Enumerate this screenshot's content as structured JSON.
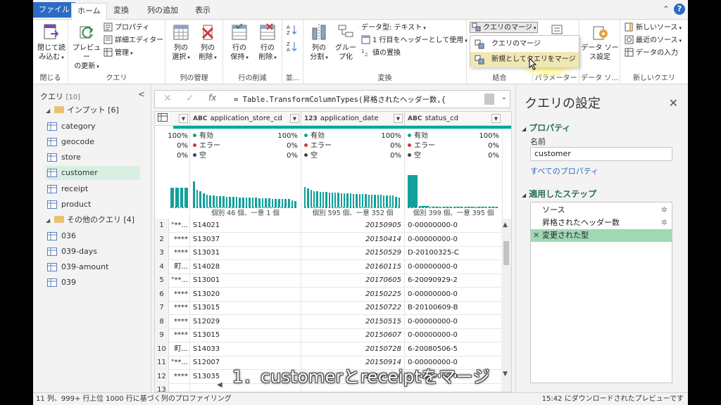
{
  "tabs": [
    "ファイル",
    "ホーム",
    "変換",
    "列の追加",
    "表示"
  ],
  "ribbon": {
    "close_group": {
      "btn": "閉じて読\nみ込む",
      "label": "閉じる"
    },
    "query_group": {
      "preview": "プレビュー\nの更新",
      "properties": "プロパティ",
      "advanced_editor": "詳細エディター",
      "manage": "管理",
      "label": "クエリ"
    },
    "columns_group": {
      "select": "列の\n選択",
      "remove": "列の\n削除",
      "label": "列の管理"
    },
    "rows_group": {
      "keep": "行の\n保持",
      "remove": "行の\n削除",
      "label": "行の削減"
    },
    "sort_group": {
      "label": "並..."
    },
    "transform_group": {
      "split": "列の\n分割",
      "group": "グルー\nプ化",
      "datatype": "データ型: テキスト",
      "first_row": "1 行目をヘッダーとして使用",
      "replace": "値の置換",
      "label": "変換"
    },
    "combine_group": {
      "merge": "クエリのマージ",
      "label": "結合"
    },
    "params_group": {
      "label": "パラメーター"
    },
    "datasource_group": {
      "btn": "データ ソー\nス設定",
      "label": "データ ソ..."
    },
    "newquery_group": {
      "new_source": "新しいソース",
      "recent": "最近のソース",
      "enter_data": "データの入力",
      "label": "新しいクエリ"
    }
  },
  "merge_dropdown": {
    "item1": "クエリのマージ",
    "item2": "新規としてクエリをマージ"
  },
  "queries": {
    "header": "クエリ",
    "count": "[10]",
    "folder1": {
      "name": "インプット [6]",
      "items": [
        "category",
        "geocode",
        "store",
        "customer",
        "receipt",
        "product"
      ]
    },
    "folder2": {
      "name": "その他のクエリ [4]",
      "items": [
        "036",
        "039-days",
        "039-amount",
        "039"
      ]
    }
  },
  "formula": "= Table.TransformColumnTypes(昇格されたヘッダー数,{",
  "columns": [
    {
      "type": "ABC",
      "name": "application_store_cd"
    },
    {
      "type": "123",
      "name": "application_date"
    },
    {
      "type": "ABC",
      "name": "status_cd"
    }
  ],
  "profile": {
    "labels": {
      "valid": "有効",
      "error": "エラー",
      "empty": "空"
    },
    "partial": {
      "valid": "100%",
      "error": "0%",
      "empty": "0%"
    },
    "cols": [
      {
        "valid": "100%",
        "error": "0%",
        "empty": "0%",
        "foot": "個別 46 個、一意 1 個"
      },
      {
        "valid": "100%",
        "error": "0%",
        "empty": "0%",
        "foot": "個別 595 個、一意 352 個"
      },
      {
        "valid": "100%",
        "error": "0%",
        "empty": "0%",
        "foot": "個別 399 個、一意 395 個"
      }
    ],
    "hist": [
      [
        0.8,
        0.55,
        0.5,
        0.44,
        0.4,
        0.38,
        0.36,
        0.35,
        0.34,
        0.34,
        0.33,
        0.33,
        0.32,
        0.32,
        0.31,
        0.31,
        0.3,
        0.3,
        0.3,
        0.3,
        0.29,
        0.28,
        0.28,
        0.28,
        0.27,
        0.27,
        0.27,
        0.26,
        0.26,
        0.26,
        0.22,
        0.2
      ],
      [
        0.62,
        0.58,
        0.55,
        0.5,
        0.5,
        0.48,
        0.48,
        0.47,
        0.46,
        0.46,
        0.45,
        0.45,
        0.44,
        0.44,
        0.43,
        0.43,
        0.42,
        0.42,
        0.42,
        0.41,
        0.41,
        0.4,
        0.4,
        0.4,
        0.39,
        0.39,
        0.38,
        0.38,
        0.37,
        0.36,
        0.32,
        0.3
      ],
      [
        1.0,
        0.04,
        0.02,
        0.02,
        0.02,
        0.02,
        0.02,
        0.02
      ]
    ]
  },
  "rows": [
    {
      "n": "1",
      "c0": "\"**...",
      "c1": "S14021",
      "c2": "20150905",
      "c3": "0-00000000-0"
    },
    {
      "n": "2",
      "c0": "****",
      "c1": "S13037",
      "c2": "20150414",
      "c3": "0-00000000-0"
    },
    {
      "n": "3",
      "c0": "****",
      "c1": "S13031",
      "c2": "20150529",
      "c3": "D-20100325-C"
    },
    {
      "n": "4",
      "c0": "町...",
      "c1": "S14028",
      "c2": "20160115",
      "c3": "0-00000000-0"
    },
    {
      "n": "5",
      "c0": "\"**...",
      "c1": "S13001",
      "c2": "20170605",
      "c3": "6-20090929-2"
    },
    {
      "n": "6",
      "c0": "****",
      "c1": "S13020",
      "c2": "20150225",
      "c3": "0-00000000-0"
    },
    {
      "n": "7",
      "c0": "****",
      "c1": "S13015",
      "c2": "20150722",
      "c3": "B-20100609-B"
    },
    {
      "n": "8",
      "c0": "****",
      "c1": "S12029",
      "c2": "20150515",
      "c3": "0-00000000-0"
    },
    {
      "n": "9",
      "c0": "****",
      "c1": "S13015",
      "c2": "20150607",
      "c3": "0-00000000-0"
    },
    {
      "n": "10",
      "c0": "町...",
      "c1": "S14033",
      "c2": "20150728",
      "c3": "6-20080506-5"
    },
    {
      "n": "11",
      "c0": "\"**...",
      "c1": "S12007",
      "c2": "20150914",
      "c3": "0-00000000-0"
    },
    {
      "n": "12",
      "c0": "****",
      "c1": "S13035",
      "c2": "20150804",
      "c3": "0-00000000-0"
    },
    {
      "n": "13",
      "c0": "",
      "c1": "",
      "c2": "",
      "c3": ""
    }
  ],
  "settings": {
    "title": "クエリの設定",
    "properties": "プロパティ",
    "name_label": "名前",
    "name_value": "customer",
    "all_properties": "すべてのプロパティ",
    "steps_title": "適用したステップ",
    "steps": [
      "ソース",
      "昇格されたヘッダー数",
      "変更された型"
    ]
  },
  "status": {
    "left": "11 列、999+ 行",
    "mid": "上位 1000 行に基づく列のプロファイリング",
    "right": "15:42 にダウンロードされたプレビューです"
  },
  "caption": "1．customerとreceiptをマージ",
  "colors": {
    "accent": "#2b6bc3",
    "teal": "#10a19a",
    "selected_step": "#9fd8b4",
    "selected_query": "#d8efe2"
  }
}
